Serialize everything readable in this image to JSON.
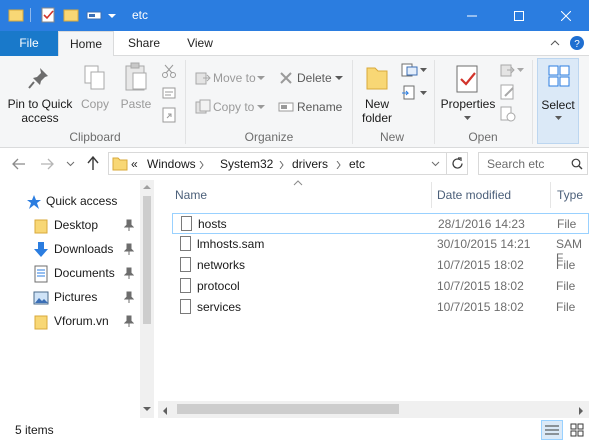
{
  "window": {
    "title": "etc"
  },
  "ribbon_tabs": {
    "file": "File",
    "home": "Home",
    "share": "Share",
    "view": "View"
  },
  "clipboard": {
    "pin_label_1": "Pin to Quick",
    "pin_label_2": "access",
    "copy": "Copy",
    "paste": "Paste",
    "group": "Clipboard"
  },
  "organize": {
    "move_to": "Move to",
    "copy_to": "Copy to",
    "delete": "Delete",
    "rename": "Rename",
    "group": "Organize"
  },
  "new": {
    "folder_1": "New",
    "folder_2": "folder",
    "group": "New"
  },
  "open": {
    "properties": "Properties",
    "group": "Open"
  },
  "select": {
    "label": "Select"
  },
  "address": {
    "overflow": "«",
    "crumbs": [
      "Windows",
      "System32",
      "drivers",
      "etc"
    ],
    "search_placeholder": "Search etc"
  },
  "nav_pane": {
    "quick_access": "Quick access",
    "items": [
      {
        "label": "Desktop",
        "icon": "folder-icon"
      },
      {
        "label": "Downloads",
        "icon": "download-icon"
      },
      {
        "label": "Documents",
        "icon": "documents-icon"
      },
      {
        "label": "Pictures",
        "icon": "pictures-icon"
      },
      {
        "label": "Vforum.vn",
        "icon": "folder-icon"
      }
    ]
  },
  "columns": {
    "name": "Name",
    "date": "Date modified",
    "type": "Type"
  },
  "files": [
    {
      "name": "hosts",
      "date": "28/1/2016 14:23",
      "type": "File"
    },
    {
      "name": "lmhosts.sam",
      "date": "30/10/2015 14:21",
      "type": "SAM F"
    },
    {
      "name": "networks",
      "date": "10/7/2015 18:02",
      "type": "File"
    },
    {
      "name": "protocol",
      "date": "10/7/2015 18:02",
      "type": "File"
    },
    {
      "name": "services",
      "date": "10/7/2015 18:02",
      "type": "File"
    }
  ],
  "status": {
    "count": "5 items"
  },
  "colors": {
    "titlebar": "#2b7de0",
    "file_tab": "#1979ca",
    "selection_border": "#99d1ff",
    "folder": "#f8d775"
  }
}
